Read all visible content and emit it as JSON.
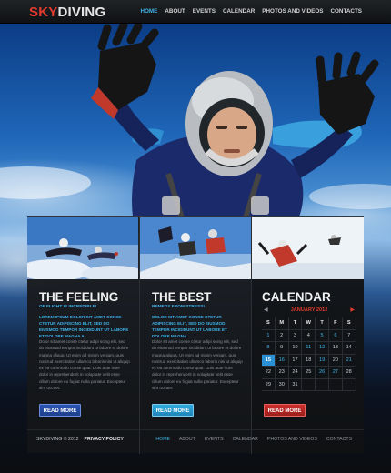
{
  "header": {
    "logo_part1": "SKY",
    "logo_part2": "DIVING",
    "nav": [
      {
        "label": "HOME",
        "active": true
      },
      {
        "label": "ABOUT"
      },
      {
        "label": "EVENTS"
      },
      {
        "label": "CALENDAR"
      },
      {
        "label": "PHOTOS AND VIDEOS"
      },
      {
        "label": "CONTACTS"
      }
    ]
  },
  "columns": [
    {
      "title": "THE FEELING",
      "subtitle": "OF FLIGHT IS INCREDIBLE!",
      "highlight": "LOREM IPSUM DOLOR SIT AMET CONSE CTETUR ADIPISCING ELIT, SED DO EIUSMOD TEMPOR INCIDIDUNT UT LABORE ET DOLORE MAGNA A",
      "body": "Dolor sit amet conse ctetur adipi scing elit, sed do eiusmod tempor incididunt ut labore et dolore magna aliqua. Ut enim ad minim veniam, quis nostrud exercitation ullamco laboris nisi ut aliquip ex ea commodo conse quat. Duis aute irure dolor in reprehenderit in voluptate velit esse cillum dolore eu fugiat nulla pariatur. Excepteur sint occaec",
      "button": "READ MORE"
    },
    {
      "title": "THE BEST",
      "subtitle": "REMEDY FROM STRESS!",
      "highlight": "DOLOR SIT AMET CONSE CTETUR ADIPISCING ELIT, SED DO EIUSMOD TEMPOR INCIDIDUNT UT LABORE ET DOLORE MAGNA",
      "body": "Dolor sit amet conse ctetur adipi scing elit, sed do eiusmod tempor incididunt ut labore et dolore magna aliqua. Ut enim ad minim veniam, quis nostrud exercitation ullamco laboris nisi ut aliquip ex ea commodo conse quat. Duis aute irure dolor in reprehenderit in voluptate velit esse cillum dolore eu fugiat nulla pariatur. Excepteur sint occaec",
      "button": "READ MORE"
    }
  ],
  "calendar": {
    "title": "CALENDAR",
    "month": "JANUARY 2012",
    "prev_arrow": "◀",
    "next_arrow": "▶",
    "weekdays": [
      "S",
      "M",
      "T",
      "W",
      "T",
      "F",
      "S"
    ],
    "weeks": [
      [
        "1",
        "2",
        "3",
        "4",
        "5",
        "6",
        "7"
      ],
      [
        "8",
        "9",
        "10",
        "11",
        "12",
        "13",
        "14"
      ],
      [
        "15",
        "16",
        "17",
        "18",
        "19",
        "20",
        "21"
      ],
      [
        "22",
        "23",
        "24",
        "25",
        "26",
        "27",
        "28"
      ],
      [
        "29",
        "30",
        "31",
        "",
        "",
        "",
        ""
      ]
    ],
    "event_days": [
      "1",
      "5",
      "6",
      "8",
      "11",
      "12",
      "15",
      "16",
      "19",
      "21",
      "26",
      "27"
    ],
    "today": "15",
    "button": "READ MORE"
  },
  "footer": {
    "copyright": "SKYDIVING © 2012",
    "privacy": "PRIVACY POLICY",
    "nav": [
      {
        "label": "HOME",
        "active": true
      },
      {
        "label": "ABOUT"
      },
      {
        "label": "EVENTS"
      },
      {
        "label": "CALENDAR"
      },
      {
        "label": "PHOTOS AND VIDEOS"
      },
      {
        "label": "CONTACTS"
      }
    ]
  },
  "colors": {
    "accent_red": "#e53b2e",
    "accent_blue": "#3fb3e8",
    "button_blue": "#2a54b3",
    "button_cyan": "#2fa9dd",
    "button_red": "#cc2e2a"
  }
}
